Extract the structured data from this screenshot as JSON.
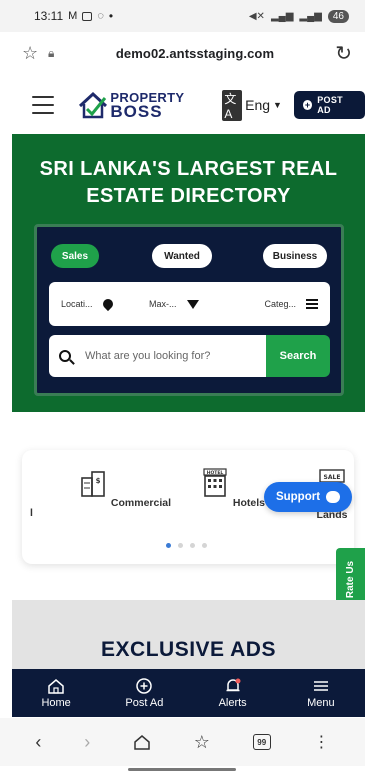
{
  "status_bar": {
    "time": "13:11",
    "battery": "46",
    "dot": "•"
  },
  "browser": {
    "url": "demo02.antsstaging.com",
    "tab_count": "99"
  },
  "header": {
    "logo_line1": "PROPERTY",
    "logo_line2": "BOSS",
    "language": "Eng",
    "post_ad": "POST AD"
  },
  "hero": {
    "title": "SRI LANKA'S LARGEST REAL ESTATE DIRECTORY",
    "tabs": [
      {
        "label": "Sales",
        "active": true
      },
      {
        "label": "Wanted",
        "active": false
      },
      {
        "label": "Business",
        "active": false
      }
    ],
    "filters": {
      "location": "Locati...",
      "max": "Max-...",
      "category": "Categ..."
    },
    "search_placeholder": "What are you looking for?",
    "search_button": "Search"
  },
  "categories": {
    "partial_label": "l",
    "items": [
      {
        "label": "Commercial",
        "icon": "commercial-building-icon"
      },
      {
        "label": "Hotels",
        "icon": "hotel-icon"
      },
      {
        "label": "Lands",
        "icon": "sale-sign-icon"
      }
    ],
    "hotel_sign": "HOTEL",
    "sale_sign": "SALE",
    "pages": 4,
    "active_page": 0
  },
  "support": {
    "label": "Support"
  },
  "rate_us": {
    "label": "Rate Us"
  },
  "exclusive": {
    "title": "EXCLUSIVE ADS"
  },
  "bottom_nav": [
    {
      "label": "Home",
      "icon": "home-icon"
    },
    {
      "label": "Post Ad",
      "icon": "plus-circle-icon"
    },
    {
      "label": "Alerts",
      "icon": "bell-icon"
    },
    {
      "label": "Menu",
      "icon": "menu-icon"
    }
  ],
  "colors": {
    "brand_green": "#0d6b2e",
    "accent_green": "#1fa14a",
    "navy": "#0c1a3a",
    "support_blue": "#1d6fe8"
  }
}
